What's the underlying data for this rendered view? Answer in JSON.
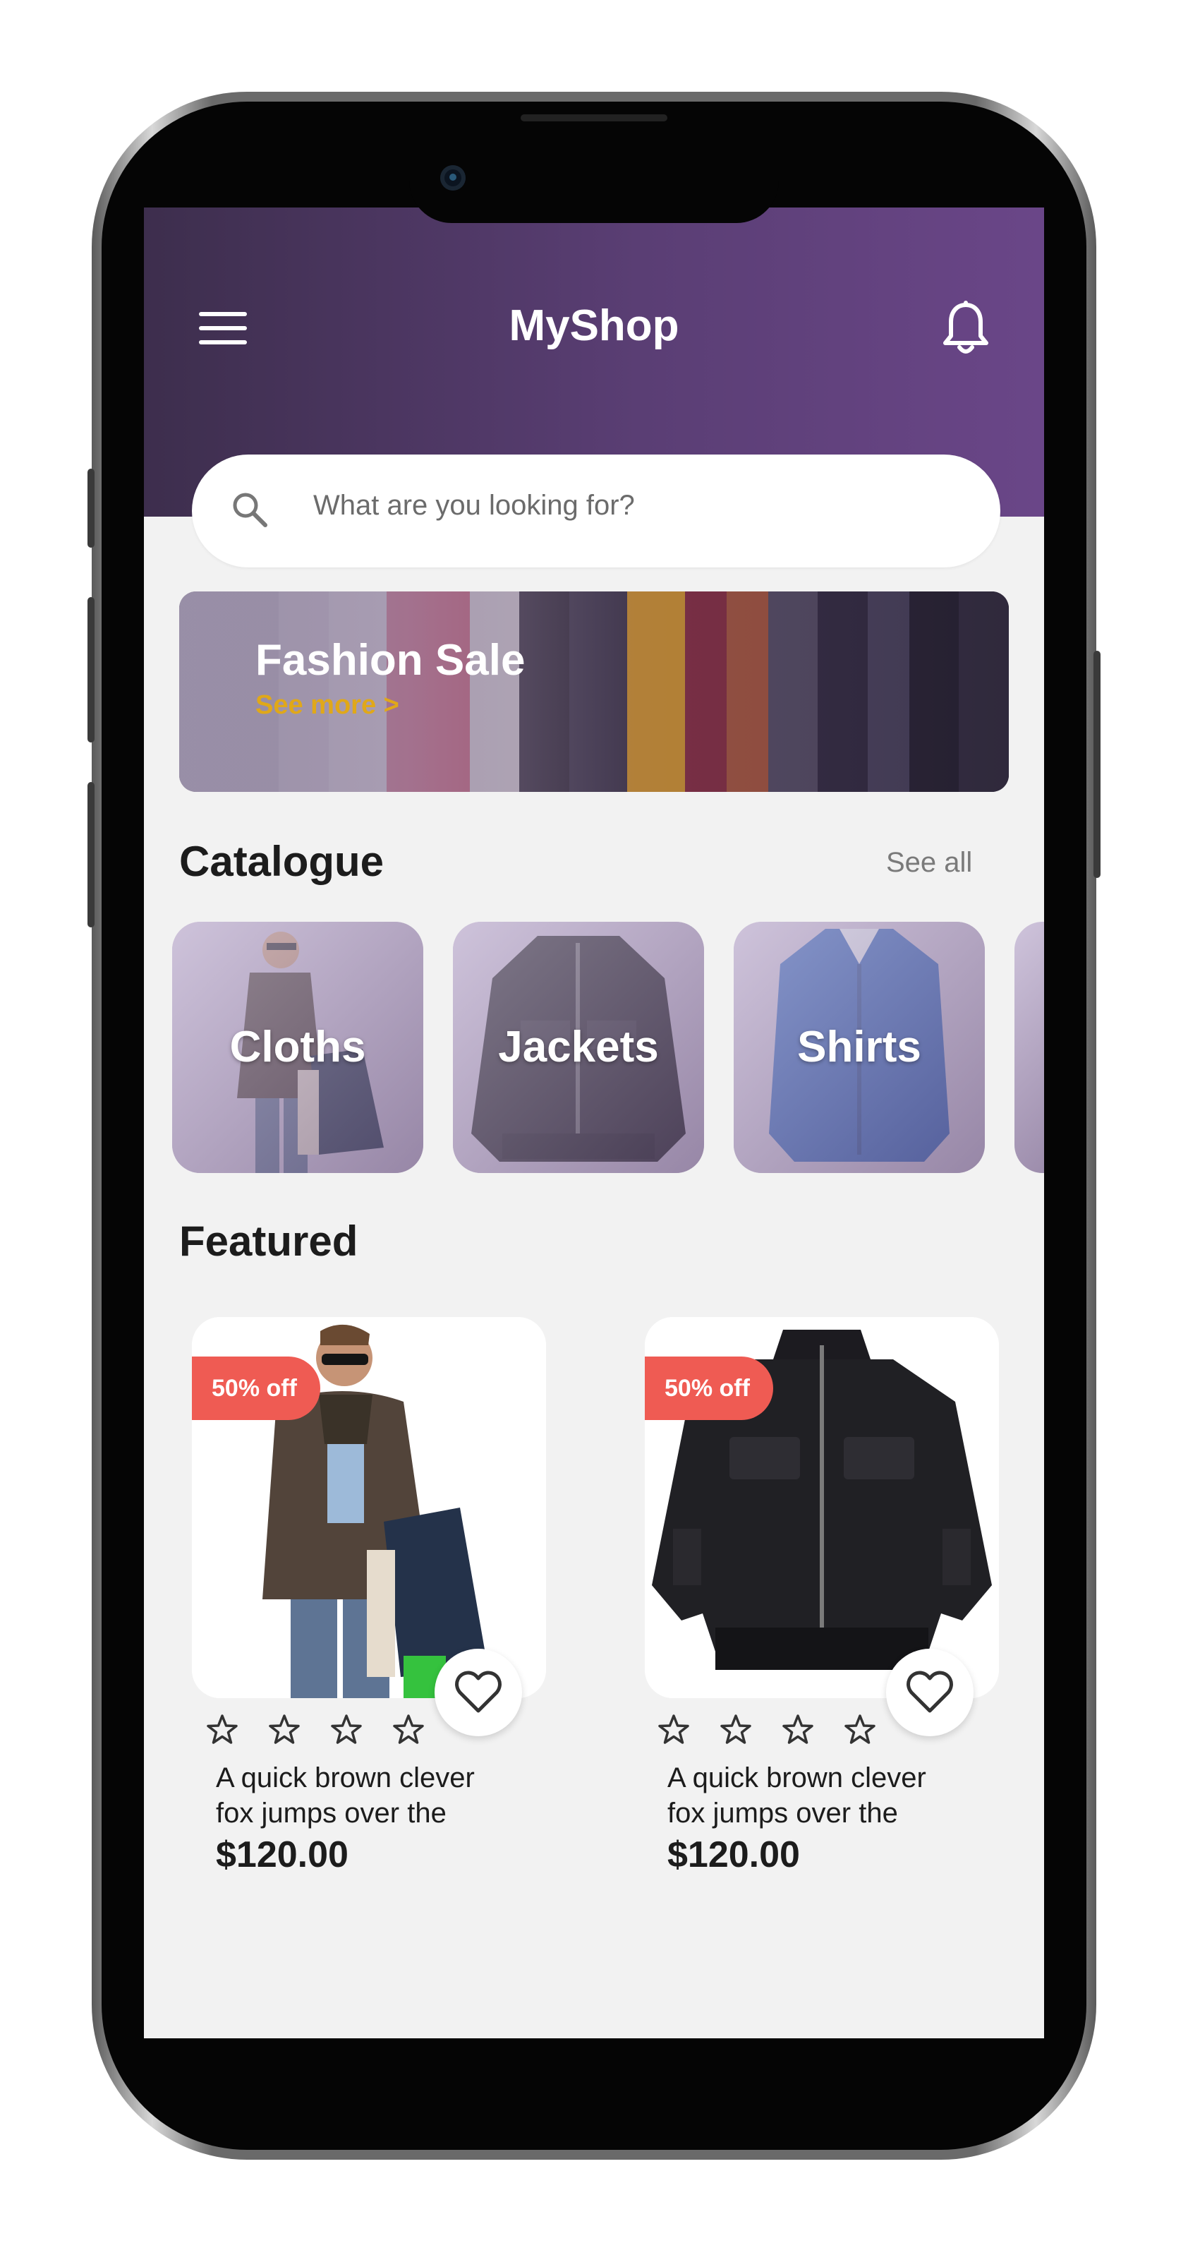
{
  "app": {
    "title": "MyShop"
  },
  "header": {
    "menu_icon": "hamburger-menu-icon",
    "notification_icon": "bell-icon"
  },
  "search": {
    "placeholder": "What are you looking for?",
    "icon": "search-icon"
  },
  "banner": {
    "title": "Fashion Sale",
    "link_label": "See more >"
  },
  "catalogue": {
    "title": "Catalogue",
    "see_all_label": "See all",
    "items": [
      {
        "label": "Cloths"
      },
      {
        "label": "Jackets"
      },
      {
        "label": "Shirts"
      }
    ]
  },
  "featured": {
    "title": "Featured",
    "products": [
      {
        "badge": "50% off",
        "rating": 0,
        "max_rating": 4,
        "name": "A quick brown clever fox jumps over the",
        "price": "$120.00"
      },
      {
        "badge": "50% off",
        "rating": 0,
        "max_rating": 4,
        "name": "A quick brown clever fox jumps over the",
        "price": "$120.00"
      }
    ]
  },
  "colors": {
    "header_gradient_start": "#3d2e4d",
    "header_gradient_end": "#6a4688",
    "accent_link": "#e0a819",
    "badge": "#ef5b53",
    "background": "#f2f2f2"
  }
}
